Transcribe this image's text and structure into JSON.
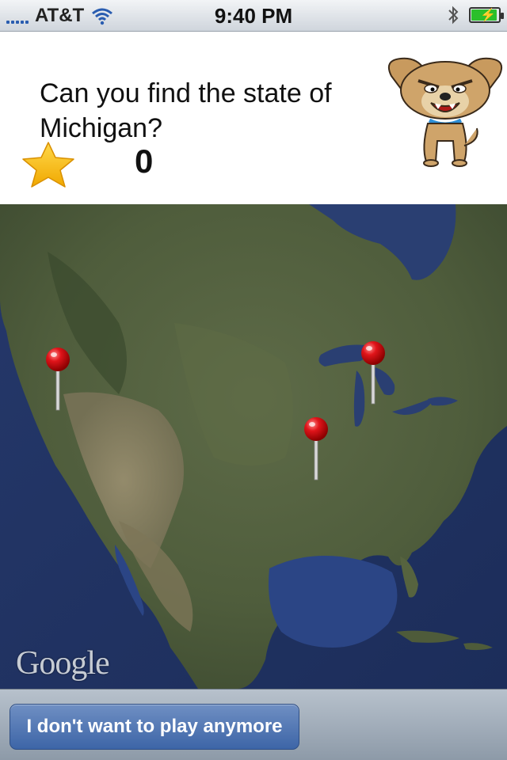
{
  "status_bar": {
    "carrier": "AT&T",
    "time": "9:40 PM",
    "signal_bars": 5,
    "battery_level": 1.0,
    "icons": [
      "signal-icon",
      "wifi-icon",
      "bluetooth-icon",
      "battery-icon"
    ]
  },
  "game": {
    "question": "Can you find the state of Michigan?",
    "score": "0"
  },
  "map": {
    "attribution": "Google",
    "pins": [
      "dropped-pin",
      "dropped-pin",
      "dropped-pin"
    ]
  },
  "toolbar": {
    "quit_label": "I don't want to play anymore"
  },
  "colors": {
    "accent": "#3d65a7",
    "pin_red": "#e0141a",
    "battery_green": "#2bbf2b",
    "star_yellow": "#f5b800"
  }
}
